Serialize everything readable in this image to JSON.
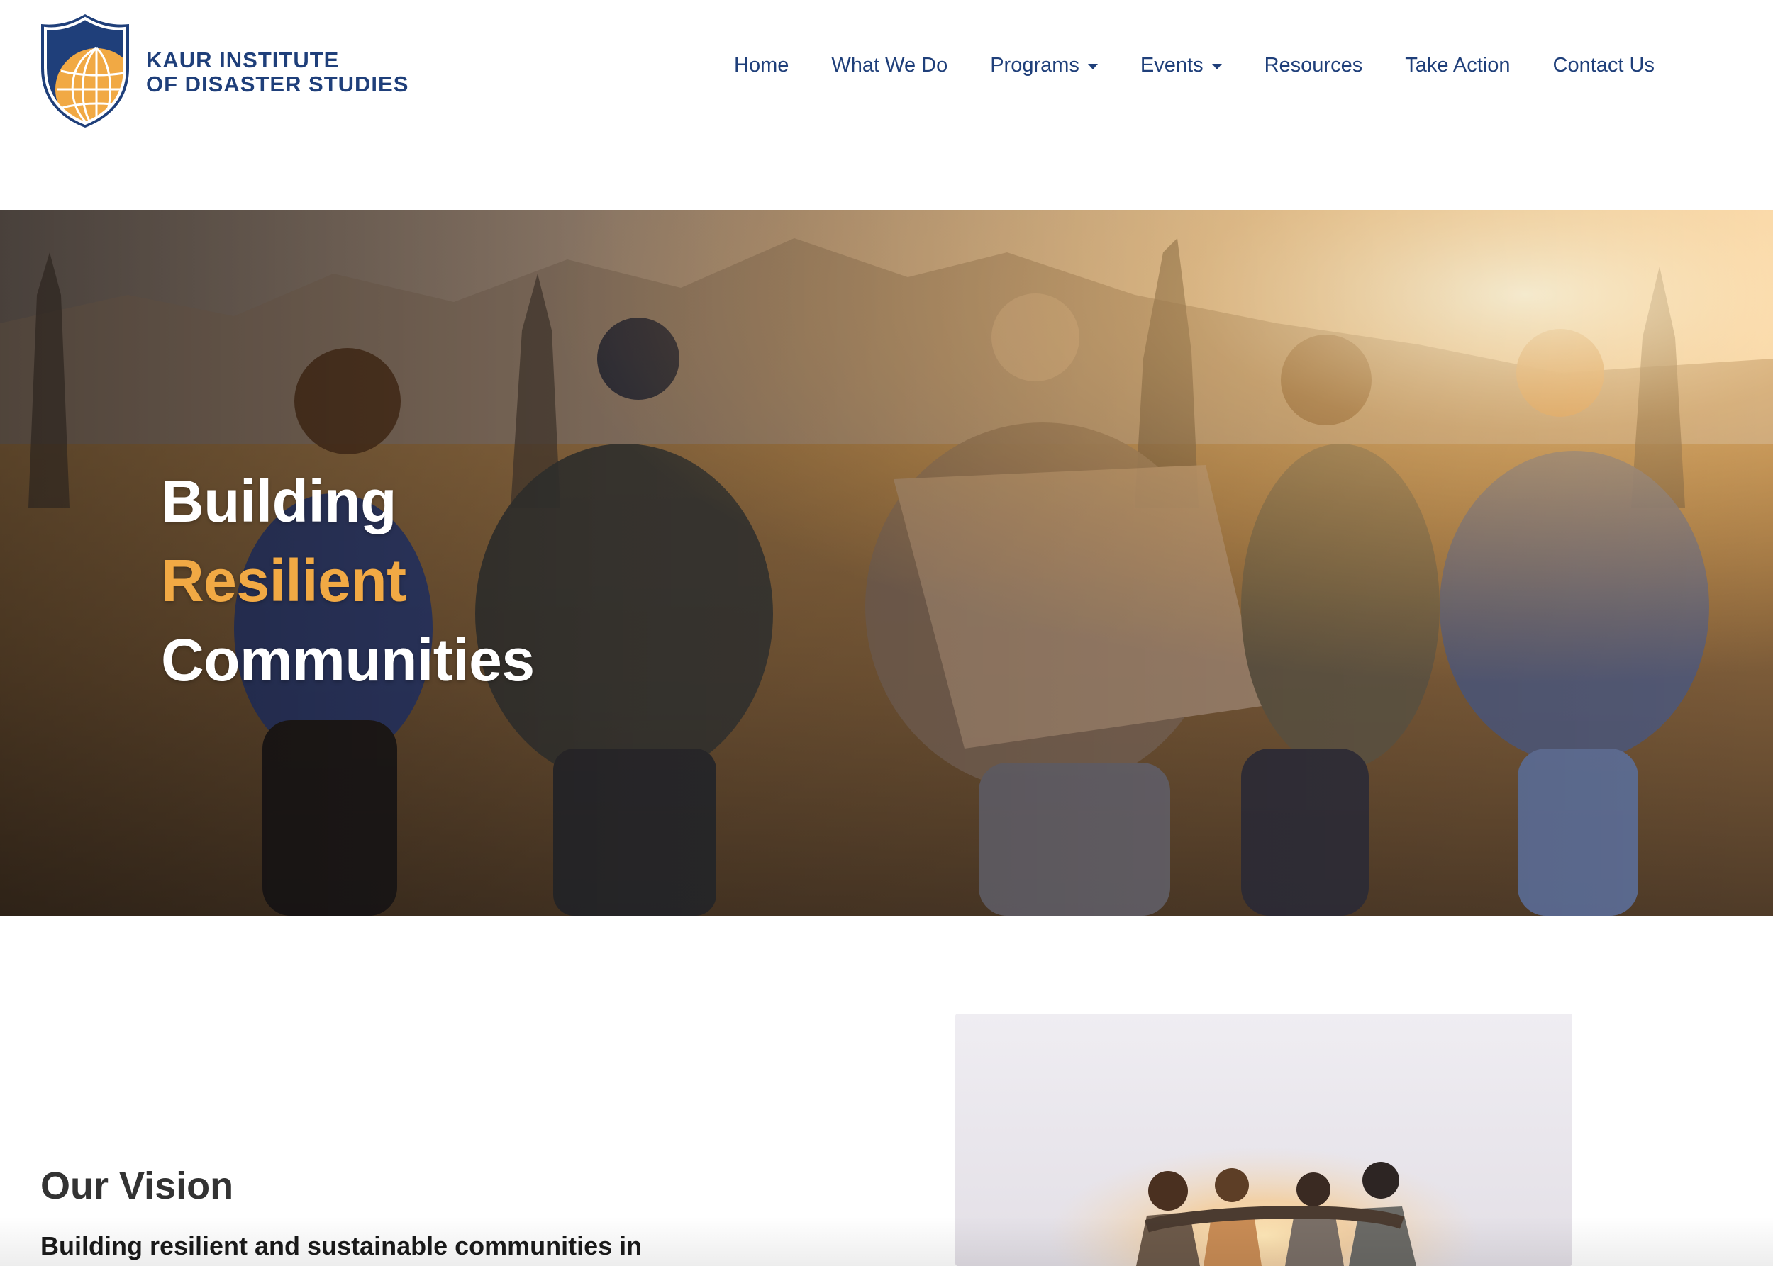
{
  "brand": {
    "line1": "KAUR INSTITUTE",
    "line2": "OF DISASTER STUDIES",
    "logo_icon": "globe-shield-icon",
    "colors": {
      "navy": "#1f3f7a",
      "gold": "#f1a944"
    }
  },
  "nav": {
    "items": [
      {
        "label": "Home"
      },
      {
        "label": "What We Do"
      },
      {
        "label": "Programs",
        "dropdown": true
      },
      {
        "label": "Events",
        "dropdown": true
      },
      {
        "label": "Resources"
      },
      {
        "label": "Take Action"
      },
      {
        "label": "Contact Us"
      }
    ],
    "dropdown_icon": "caret-down-icon"
  },
  "hero": {
    "line1": "Building",
    "line2": "Resilient",
    "line3": "Communities",
    "accent_color": "#f1a944",
    "image": "group-running-desert-sunset-photo"
  },
  "vision": {
    "title": "Our Vision",
    "text": "Building resilient and sustainable communities in",
    "image": "group-embracing-sunset-photo"
  }
}
